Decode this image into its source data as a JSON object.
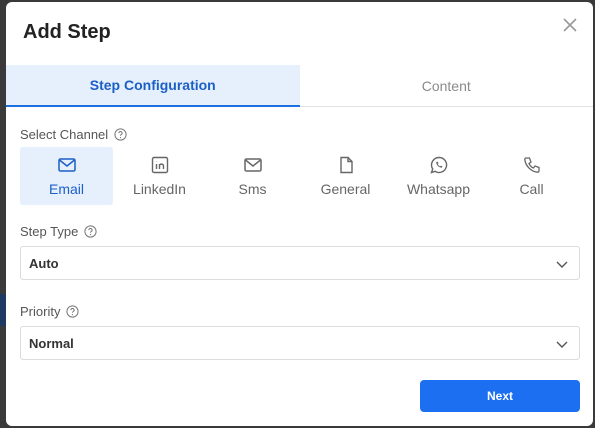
{
  "modal": {
    "title": "Add Step"
  },
  "tabs": [
    {
      "label": "Step Configuration",
      "active": true
    },
    {
      "label": "Content",
      "active": false
    }
  ],
  "channel": {
    "label": "Select Channel",
    "options": [
      {
        "label": "Email",
        "icon": "mail-icon",
        "selected": true
      },
      {
        "label": "LinkedIn",
        "icon": "linkedin-icon",
        "selected": false
      },
      {
        "label": "Sms",
        "icon": "sms-icon",
        "selected": false
      },
      {
        "label": "General",
        "icon": "file-icon",
        "selected": false
      },
      {
        "label": "Whatsapp",
        "icon": "whatsapp-icon",
        "selected": false
      },
      {
        "label": "Call",
        "icon": "phone-icon",
        "selected": false
      }
    ]
  },
  "step_type": {
    "label": "Step Type",
    "value": "Auto"
  },
  "priority": {
    "label": "Priority",
    "value": "Normal"
  },
  "actions": {
    "next_label": "Next"
  },
  "colors": {
    "accent": "#1b6ff0",
    "accent_light": "#e6f0fc",
    "accent_text": "#1b5fc7"
  }
}
